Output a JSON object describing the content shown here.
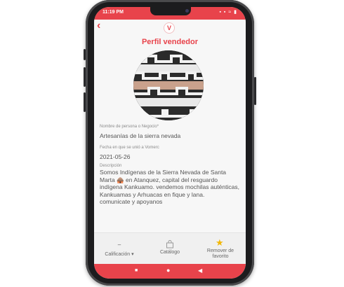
{
  "status": {
    "time": "11:19 PM",
    "icons": "▪ ▪ ≈ ▮"
  },
  "header": {
    "back_icon": "back-arrow-icon",
    "logo_text": "V",
    "title": "Perfil vendedor"
  },
  "profile": {
    "name_label": "Nombre de persona o Negocio*",
    "name_value": "Artesanías de la sierra nevada",
    "date_label": "Fecha en que se unió a Vomerc",
    "date_value": "2021-05-26",
    "desc_label": "Descripción",
    "desc_value": "Somos Indígenas de la Sierra Nevada de Santa Marta 🛖 en Atanquez, capital del resguardo indígena Kankuamo. vendemos mochilas auténticas, Kankuamas y Arhuacas en fique y lana.\ncomunicate y apoyanos"
  },
  "bottom_bar": {
    "rating_value": "–",
    "rating_label": "Calificación ▾",
    "catalog_label": "Catálogo",
    "favorite_label": "Remover de favorito"
  },
  "nav": {
    "square": "■",
    "circle": "●",
    "back": "◀"
  },
  "colors": {
    "accent": "#e8434b",
    "favorite": "#f2b705"
  }
}
